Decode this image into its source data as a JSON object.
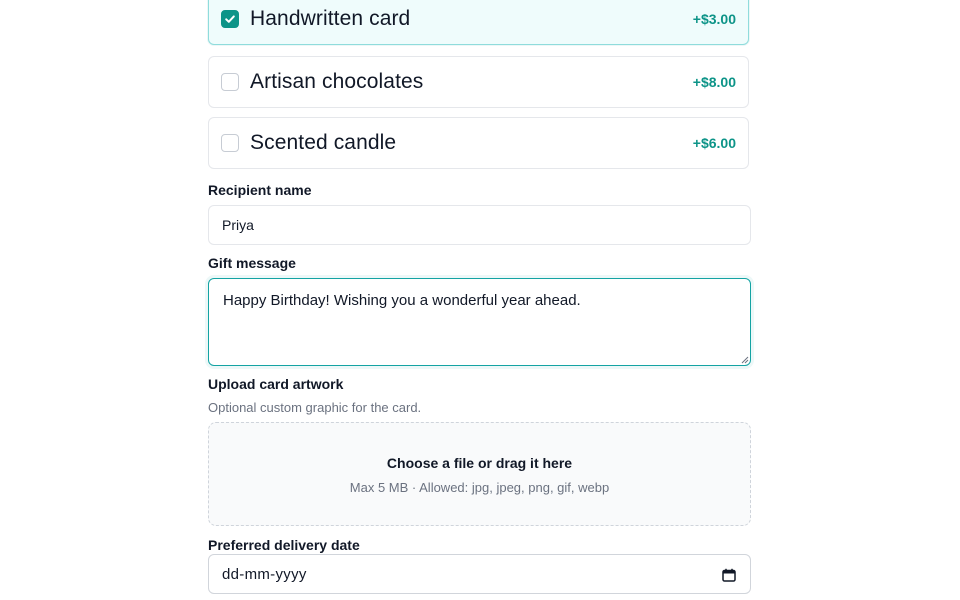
{
  "addons": [
    {
      "label": "Handwritten card",
      "price": "+$3.00",
      "checked": true
    },
    {
      "label": "Artisan chocolates",
      "price": "+$8.00",
      "checked": false
    },
    {
      "label": "Scented candle",
      "price": "+$6.00",
      "checked": false
    }
  ],
  "recipient": {
    "label": "Recipient name",
    "value": "Priya"
  },
  "message": {
    "label": "Gift message",
    "value": "Happy Birthday! Wishing you a wonderful year ahead."
  },
  "upload": {
    "label": "Upload card artwork",
    "helper": "Optional custom graphic for the card.",
    "title": "Choose a file or drag it here",
    "subtitle": "Max 5 MB · Allowed: jpg, jpeg, png, gif, webp"
  },
  "delivery": {
    "label": "Preferred delivery date",
    "placeholder": "dd-mm-yyyy"
  },
  "colors": {
    "accent": "#0d9488",
    "selected_bg": "#effcfc",
    "border": "#e5e7eb",
    "muted_text": "#6b7280"
  },
  "icons": {
    "check": "check-icon",
    "calendar": "calendar-icon",
    "resize": "resize-grip-icon"
  }
}
